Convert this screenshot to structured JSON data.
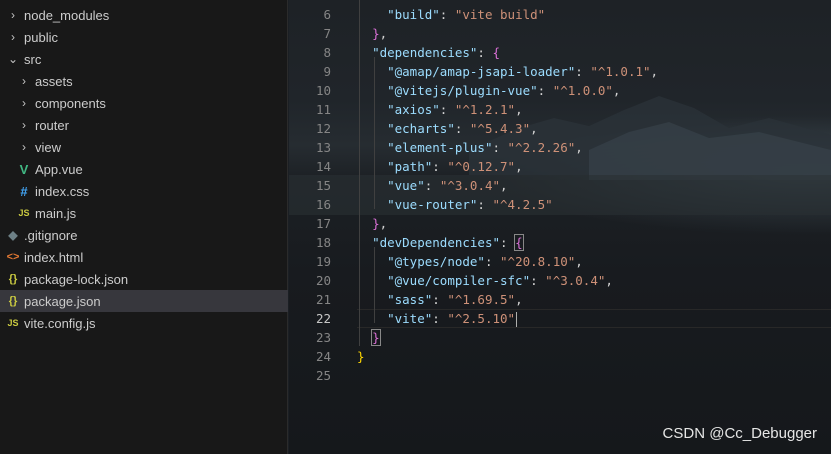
{
  "explorer": {
    "items": [
      {
        "label": "node_modules",
        "type": "folder",
        "expanded": false,
        "depth": 0
      },
      {
        "label": "public",
        "type": "folder",
        "expanded": false,
        "depth": 0
      },
      {
        "label": "src",
        "type": "folder",
        "expanded": true,
        "depth": 0
      },
      {
        "label": "assets",
        "type": "folder",
        "expanded": false,
        "depth": 1
      },
      {
        "label": "components",
        "type": "folder",
        "expanded": false,
        "depth": 1
      },
      {
        "label": "router",
        "type": "folder",
        "expanded": false,
        "depth": 1
      },
      {
        "label": "view",
        "type": "folder",
        "expanded": false,
        "depth": 1
      },
      {
        "label": "App.vue",
        "type": "vue",
        "depth": 1
      },
      {
        "label": "index.css",
        "type": "css",
        "depth": 1
      },
      {
        "label": "main.js",
        "type": "js",
        "depth": 1
      },
      {
        "label": ".gitignore",
        "type": "git",
        "depth": 0
      },
      {
        "label": "index.html",
        "type": "html",
        "depth": 0
      },
      {
        "label": "package-lock.json",
        "type": "json",
        "depth": 0
      },
      {
        "label": "package.json",
        "type": "json",
        "depth": 0,
        "selected": true
      },
      {
        "label": "vite.config.js",
        "type": "js",
        "depth": 0
      }
    ],
    "icons": {
      "vue": "V",
      "css": "#",
      "js": "JS",
      "git": "◆",
      "html": "<>",
      "json": "{}",
      "chevron_right": "›",
      "chevron_down": "⌄"
    }
  },
  "editor": {
    "active_line": 22,
    "lines": [
      {
        "n": "6",
        "tokens": [
          [
            "p",
            "    "
          ],
          [
            "k",
            "\"build\""
          ],
          [
            "p",
            ": "
          ],
          [
            "s",
            "\"vite build\""
          ]
        ]
      },
      {
        "n": "7",
        "tokens": [
          [
            "p",
            "  "
          ],
          [
            "b2",
            "}"
          ],
          [
            "p",
            ","
          ]
        ]
      },
      {
        "n": "8",
        "tokens": [
          [
            "p",
            "  "
          ],
          [
            "k",
            "\"dependencies\""
          ],
          [
            "p",
            ": "
          ],
          [
            "b2",
            "{"
          ]
        ]
      },
      {
        "n": "9",
        "tokens": [
          [
            "p",
            "    "
          ],
          [
            "k",
            "\"@amap/amap-jsapi-loader\""
          ],
          [
            "p",
            ": "
          ],
          [
            "s",
            "\"^1.0.1\""
          ],
          [
            "p",
            ","
          ]
        ]
      },
      {
        "n": "10",
        "tokens": [
          [
            "p",
            "    "
          ],
          [
            "k",
            "\"@vitejs/plugin-vue\""
          ],
          [
            "p",
            ": "
          ],
          [
            "s",
            "\"^1.0.0\""
          ],
          [
            "p",
            ","
          ]
        ]
      },
      {
        "n": "11",
        "tokens": [
          [
            "p",
            "    "
          ],
          [
            "k",
            "\"axios\""
          ],
          [
            "p",
            ": "
          ],
          [
            "s",
            "\"^1.2.1\""
          ],
          [
            "p",
            ","
          ]
        ]
      },
      {
        "n": "12",
        "tokens": [
          [
            "p",
            "    "
          ],
          [
            "k",
            "\"echarts\""
          ],
          [
            "p",
            ": "
          ],
          [
            "s",
            "\"^5.4.3\""
          ],
          [
            "p",
            ","
          ]
        ]
      },
      {
        "n": "13",
        "tokens": [
          [
            "p",
            "    "
          ],
          [
            "k",
            "\"element-plus\""
          ],
          [
            "p",
            ": "
          ],
          [
            "s",
            "\"^2.2.26\""
          ],
          [
            "p",
            ","
          ]
        ]
      },
      {
        "n": "14",
        "tokens": [
          [
            "p",
            "    "
          ],
          [
            "k",
            "\"path\""
          ],
          [
            "p",
            ": "
          ],
          [
            "s",
            "\"^0.12.7\""
          ],
          [
            "p",
            ","
          ]
        ]
      },
      {
        "n": "15",
        "tokens": [
          [
            "p",
            "    "
          ],
          [
            "k",
            "\"vue\""
          ],
          [
            "p",
            ": "
          ],
          [
            "s",
            "\"^3.0.4\""
          ],
          [
            "p",
            ","
          ]
        ]
      },
      {
        "n": "16",
        "tokens": [
          [
            "p",
            "    "
          ],
          [
            "k",
            "\"vue-router\""
          ],
          [
            "p",
            ": "
          ],
          [
            "s",
            "\"^4.2.5\""
          ]
        ]
      },
      {
        "n": "17",
        "tokens": [
          [
            "p",
            "  "
          ],
          [
            "b2",
            "}"
          ],
          [
            "p",
            ","
          ]
        ]
      },
      {
        "n": "18",
        "tokens": [
          [
            "p",
            "  "
          ],
          [
            "k",
            "\"devDependencies\""
          ],
          [
            "p",
            ": "
          ],
          [
            "b2m",
            "{"
          ]
        ]
      },
      {
        "n": "19",
        "tokens": [
          [
            "p",
            "    "
          ],
          [
            "k",
            "\"@types/node\""
          ],
          [
            "p",
            ": "
          ],
          [
            "s",
            "\"^20.8.10\""
          ],
          [
            "p",
            ","
          ]
        ]
      },
      {
        "n": "20",
        "tokens": [
          [
            "p",
            "    "
          ],
          [
            "k",
            "\"@vue/compiler-sfc\""
          ],
          [
            "p",
            ": "
          ],
          [
            "s",
            "\"^3.0.4\""
          ],
          [
            "p",
            ","
          ]
        ]
      },
      {
        "n": "21",
        "tokens": [
          [
            "p",
            "    "
          ],
          [
            "k",
            "\"sass\""
          ],
          [
            "p",
            ": "
          ],
          [
            "s",
            "\"^1.69.5\""
          ],
          [
            "p",
            ","
          ]
        ]
      },
      {
        "n": "22",
        "tokens": [
          [
            "p",
            "    "
          ],
          [
            "k",
            "\"vite\""
          ],
          [
            "p",
            ": "
          ],
          [
            "s",
            "\"^2.5.10\""
          ],
          [
            "cursor",
            ""
          ]
        ]
      },
      {
        "n": "23",
        "tokens": [
          [
            "p",
            "  "
          ],
          [
            "b2m",
            "}"
          ]
        ]
      },
      {
        "n": "24",
        "tokens": [
          [
            "b1",
            "}"
          ]
        ]
      },
      {
        "n": "25",
        "tokens": []
      }
    ]
  },
  "watermark": "CSDN @Cc_Debugger"
}
